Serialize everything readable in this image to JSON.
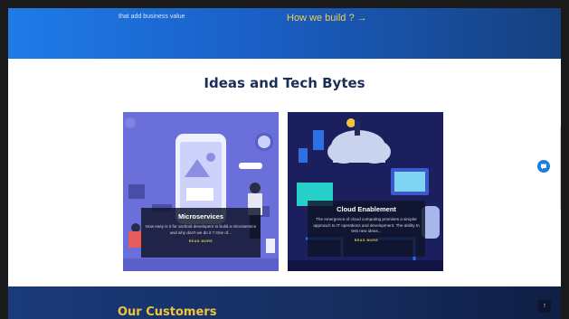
{
  "hero": {
    "tagline": "that add business value",
    "link_label": "How we build ? →"
  },
  "section": {
    "title": "Ideas and Tech Bytes"
  },
  "cards": [
    {
      "title": "Microservices",
      "description": "How easy is it for android developers to build a microservice and why don't we do it ? One of...",
      "action": "READ MORE"
    },
    {
      "title": "Cloud Enablement",
      "description": "The emergence of cloud computing promises a simpler approach to IT operations and development. The ability to test new ideas...",
      "action": "READ MORE"
    }
  ],
  "customers": {
    "title": "Our Customers",
    "back_to_top": "↑"
  },
  "colors": {
    "accent": "#f0d24a",
    "heading": "#1b2e57",
    "chat": "#1e7be0"
  },
  "icons": [
    "chat-icon",
    "arrow-up-icon"
  ]
}
